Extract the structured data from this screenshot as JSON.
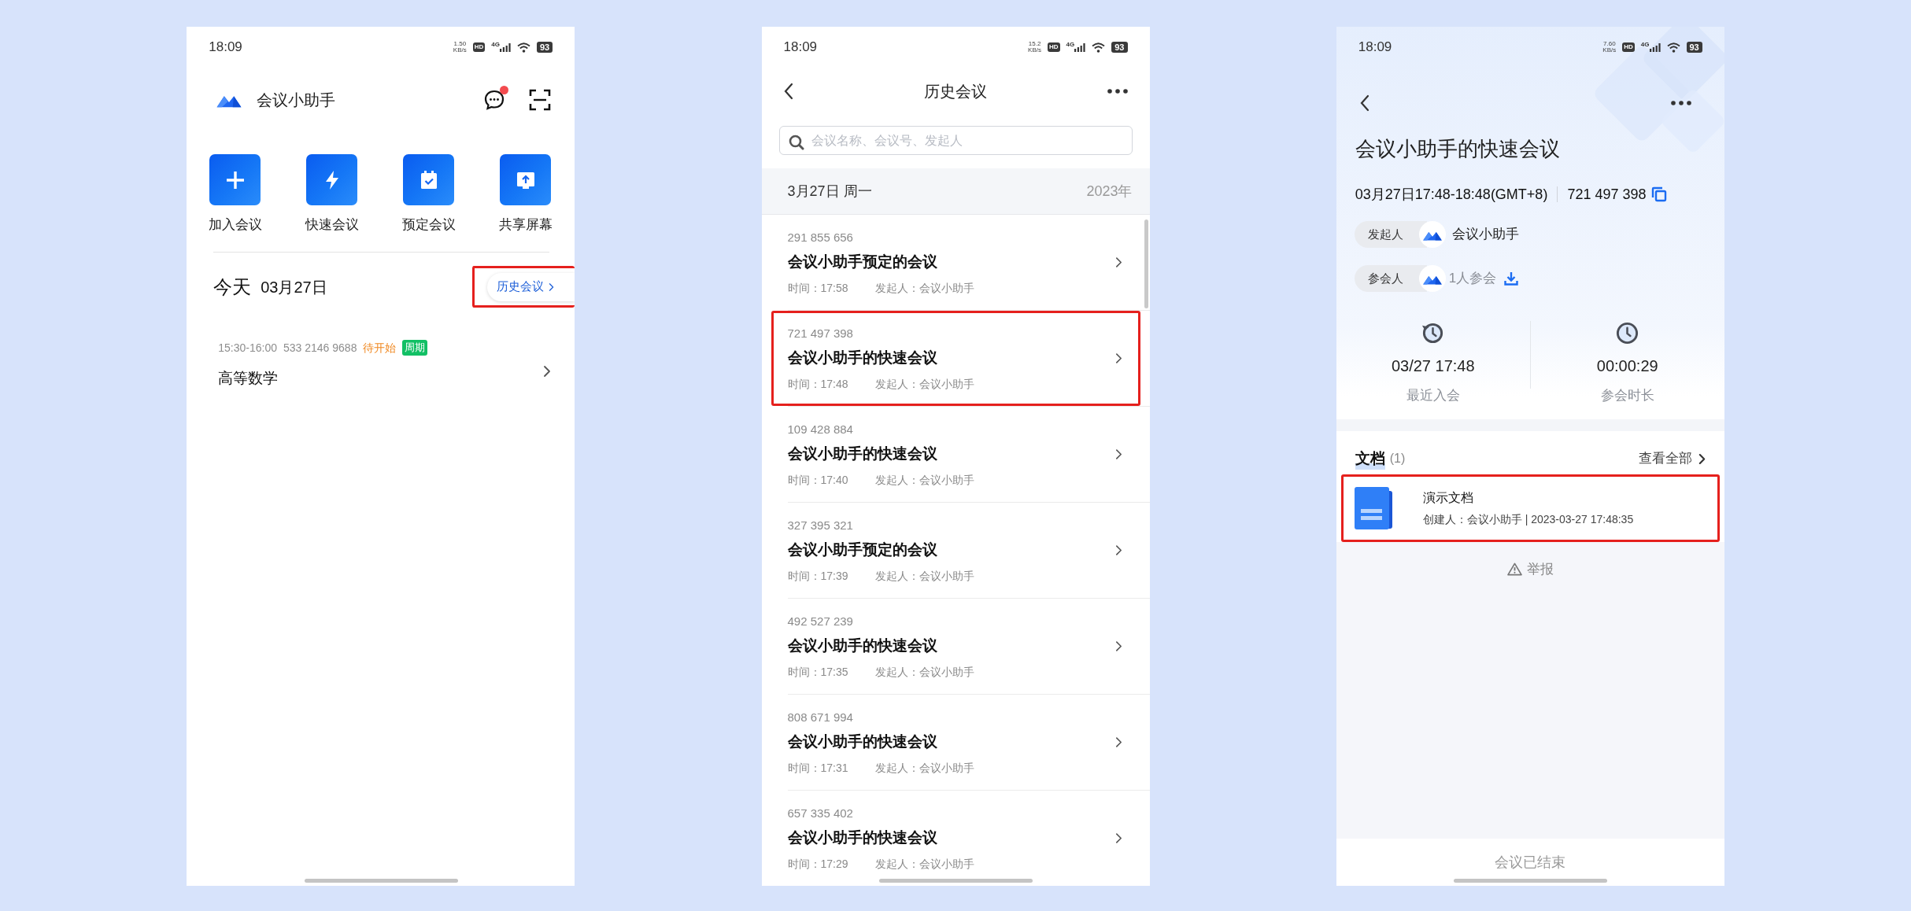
{
  "home": {
    "status_bar": {
      "time": "18:09",
      "speed": "1.50",
      "speed_unit": "KB/s",
      "hd": "HD",
      "network": "4G",
      "battery": "93"
    },
    "app_title": "会议小助手",
    "unread": true,
    "actions": [
      {
        "label": "加入会议"
      },
      {
        "label": "快速会议"
      },
      {
        "label": "预定会议"
      },
      {
        "label": "共享屏幕"
      }
    ],
    "today": {
      "label": "今天",
      "date": "03月27日"
    },
    "history_link": {
      "label": "历史会议",
      "highlighted": true
    },
    "meetings": [
      {
        "time": "15:30-16:00",
        "number": "533 2146 9688",
        "status": "待开始",
        "tag": "周期",
        "title": "高等数学"
      }
    ]
  },
  "history": {
    "status_bar": {
      "time": "18:09",
      "speed": "15.2",
      "speed_unit": "KB/s",
      "hd": "HD",
      "network": "4G",
      "battery": "93"
    },
    "title": "历史会议",
    "search": {
      "placeholder": "会议名称、会议号、发起人"
    },
    "date_group": {
      "date": "3月27日 周一",
      "year": "2023年"
    },
    "meetings": [
      {
        "number": "291 855 656",
        "title": "会议小助手预定的会议",
        "time": "时间：17:58",
        "host": "发起人：会议小助手",
        "highlighted": false
      },
      {
        "number": "721 497 398",
        "title": "会议小助手的快速会议",
        "time": "时间：17:48",
        "host": "发起人：会议小助手",
        "highlighted": true
      },
      {
        "number": "109 428 884",
        "title": "会议小助手的快速会议",
        "time": "时间：17:40",
        "host": "发起人：会议小助手",
        "highlighted": false
      },
      {
        "number": "327 395 321",
        "title": "会议小助手预定的会议",
        "time": "时间：17:39",
        "host": "发起人：会议小助手",
        "highlighted": false
      },
      {
        "number": "492 527 239",
        "title": "会议小助手的快速会议",
        "time": "时间：17:35",
        "host": "发起人：会议小助手",
        "highlighted": false
      },
      {
        "number": "808 671 994",
        "title": "会议小助手的快速会议",
        "time": "时间：17:31",
        "host": "发起人：会议小助手",
        "highlighted": false
      },
      {
        "number": "657 335 402",
        "title": "会议小助手的快速会议",
        "time": "时间：17:29",
        "host": "发起人：会议小助手",
        "highlighted": false
      }
    ]
  },
  "detail": {
    "status_bar": {
      "time": "18:09",
      "speed": "7.60",
      "speed_unit": "KB/s",
      "hd": "HD",
      "network": "4G",
      "battery": "93"
    },
    "title": "会议小助手的快速会议",
    "schedule": "03月27日17:48-18:48(GMT+8)",
    "meeting_number": "721 497 398",
    "host": {
      "label": "发起人",
      "name": "会议小助手"
    },
    "participants": {
      "label": "参会人",
      "count": "1人参会"
    },
    "stats": [
      {
        "value": "03/27 17:48",
        "label": "最近入会"
      },
      {
        "value": "00:00:29",
        "label": "参会时长"
      }
    ],
    "documents": {
      "title": "文档",
      "count": "(1)",
      "view_all": "查看全部",
      "items": [
        {
          "name": "演示文档",
          "meta": "创建人：会议小助手 | 2023-03-27 17:48:35",
          "highlighted": true
        }
      ]
    },
    "report": "举报",
    "footer": "会议已结束"
  }
}
